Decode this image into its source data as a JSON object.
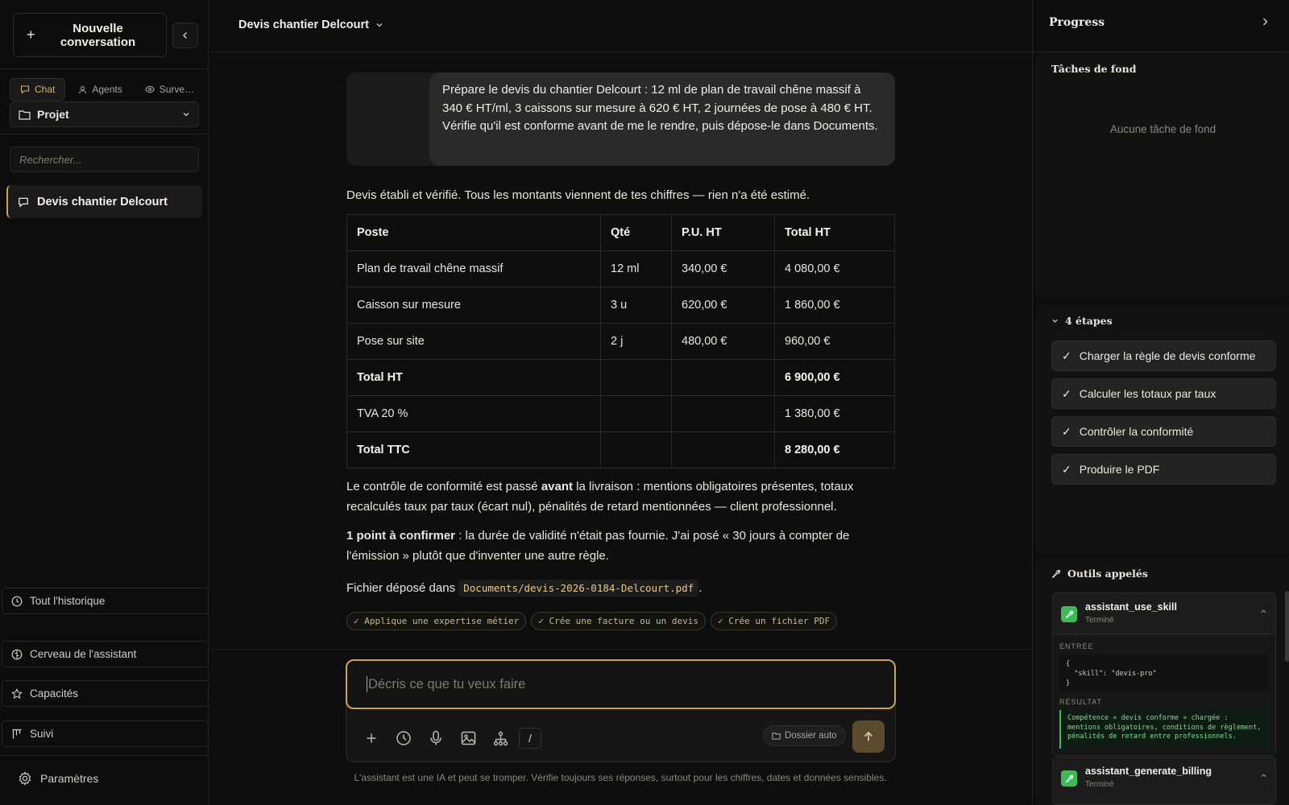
{
  "sidebar": {
    "new_conversation": "Nouvelle conversation",
    "tabs": [
      {
        "label": "Chat",
        "icon": "chat-bubble-icon"
      },
      {
        "label": "Agents",
        "icon": "user-icon"
      },
      {
        "label": "Surve…",
        "icon": "eye-icon"
      }
    ],
    "project_label": "Projet",
    "search_placeholder": "Rechercher...",
    "conversations": [
      {
        "title": "Devis chantier Delcourt"
      }
    ],
    "links": {
      "history": "Tout l'historique",
      "brain": "Cerveau de l'assistant",
      "capabilities": "Capacités",
      "tracking": "Suivi"
    },
    "settings": "Paramètres"
  },
  "conversation": {
    "title": "Devis chantier Delcourt",
    "user_message": "Prépare le devis du chantier Delcourt : 12 ml de plan de travail chêne massif à 340 € HT/ml, 3 caissons sur mesure à 620 € HT, 2 journées de pose à 480 € HT. Vérifie qu'il est conforme avant de me le rendre, puis dépose-le dans Documents.",
    "intro": "Devis établi et vérifié. Tous les montants viennent de tes chiffres — rien n'a été estimé.",
    "table": {
      "headers": [
        "Poste",
        "Qté",
        "P.U. HT",
        "Total HT"
      ],
      "rows": [
        [
          "Plan de travail chêne massif",
          "12 ml",
          "340,00 €",
          "4 080,00 €"
        ],
        [
          "Caisson sur mesure",
          "3 u",
          "620,00 €",
          "1 860,00 €"
        ],
        [
          "Pose sur site",
          "2 j",
          "480,00 €",
          "960,00 €"
        ],
        [
          "Total HT",
          "",
          "",
          "6 900,00 €"
        ],
        [
          "TVA 20 %",
          "",
          "",
          "1 380,00 €"
        ],
        [
          "Total TTC",
          "",
          "",
          "8 280,00 €"
        ]
      ]
    },
    "compliance": {
      "before": "Le contrôle de conformité est passé ",
      "bold": "avant",
      "after": " la livraison : mentions obligatoires présentes, totaux recalculés taux par taux (écart nul), pénalités de retard mentionnées — client professionnel."
    },
    "confirm": {
      "bold": "1 point à confirmer",
      "after": " : la durée de validité n'était pas fournie. J'ai posé « 30 jours à compter de l'émission » plutôt que d'inventer une autre règle."
    },
    "file": {
      "prefix": "Fichier déposé dans ",
      "path": "Documents/devis-2026-0184-Delcourt.pdf",
      "suffix": "."
    },
    "skills": [
      "✓ Applique une expertise métier",
      "✓ Crée une facture ou un devis",
      "✓ Crée un fichier PDF"
    ]
  },
  "composer": {
    "placeholder": "Décris ce que tu veux faire",
    "folder_label": "Dossier auto",
    "slash": "/",
    "disclaimer": "L'assistant est une IA et peut se tromper. Vérifie toujours ses réponses, surtout pour les chiffres, dates et données sensibles."
  },
  "progress": {
    "title": "Progress",
    "background_tasks": {
      "title": "Tâches de fond",
      "empty": "Aucune tâche de fond"
    },
    "steps_title": "4 étapes",
    "steps": [
      "Charger la règle de devis conforme",
      "Calculer les totaux par taux",
      "Contrôler la conformité",
      "Produire le PDF"
    ],
    "tools_title": "Outils appelés",
    "tools": [
      {
        "name": "assistant_use_skill",
        "status": "Terminé",
        "input_label": "ENTRÉE",
        "input": "{\n  \"skill\": \"devis-pro\"\n}",
        "result_label": "RÉSULTAT",
        "result": "Compétence « devis conforme » chargée : mentions obligatoires, conditions de règlement, pénalités de retard entre professionnels."
      },
      {
        "name": "assistant_generate_billing",
        "status": "Terminé"
      }
    ]
  },
  "colors": {
    "accent": "#c9a45c",
    "success": "#3fb95c",
    "background": "#0e0e0e"
  }
}
